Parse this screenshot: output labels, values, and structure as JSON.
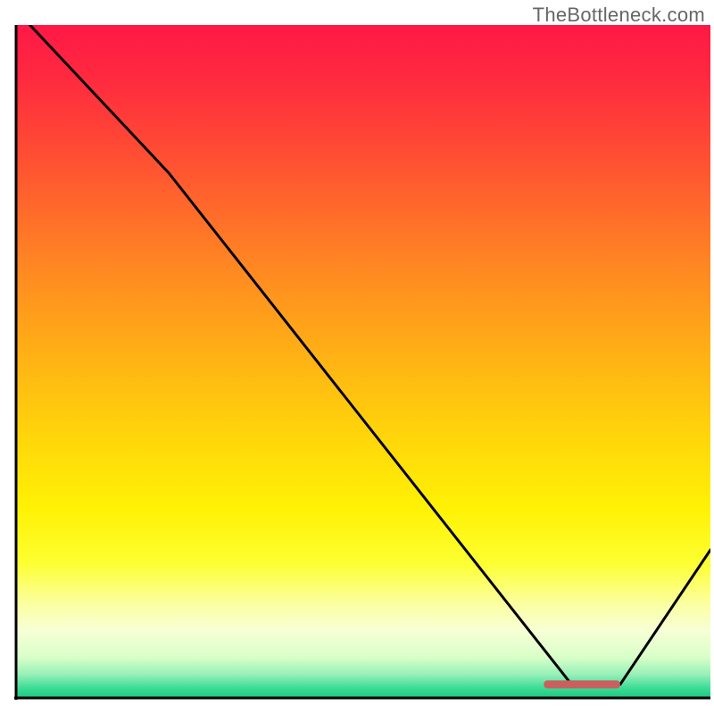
{
  "watermark": "TheBottleneck.com",
  "chart_data": {
    "type": "line",
    "title": "",
    "xlabel": "",
    "ylabel": "",
    "xlim": [
      0,
      100
    ],
    "ylim": [
      0,
      100
    ],
    "curve_points": [
      {
        "x": 2,
        "y": 100
      },
      {
        "x": 22,
        "y": 78
      },
      {
        "x": 80,
        "y": 2
      },
      {
        "x": 87,
        "y": 2
      },
      {
        "x": 100,
        "y": 22
      }
    ],
    "optimal_segment": {
      "x_start": 76,
      "x_end": 87,
      "y": 2
    },
    "gradient_stops": [
      {
        "offset": 0.0,
        "color": "#ff1846"
      },
      {
        "offset": 0.08,
        "color": "#ff2a3f"
      },
      {
        "offset": 0.2,
        "color": "#ff5032"
      },
      {
        "offset": 0.35,
        "color": "#ff8423"
      },
      {
        "offset": 0.5,
        "color": "#ffb414"
      },
      {
        "offset": 0.62,
        "color": "#ffd80a"
      },
      {
        "offset": 0.72,
        "color": "#fff205"
      },
      {
        "offset": 0.8,
        "color": "#fdff32"
      },
      {
        "offset": 0.86,
        "color": "#fbffa0"
      },
      {
        "offset": 0.9,
        "color": "#f7ffd6"
      },
      {
        "offset": 0.94,
        "color": "#d8ffc8"
      },
      {
        "offset": 0.965,
        "color": "#97f0b8"
      },
      {
        "offset": 0.985,
        "color": "#3ddc97"
      },
      {
        "offset": 1.0,
        "color": "#19c97f"
      }
    ],
    "marker_color": "#c96060",
    "axis_color": "#000000",
    "curve_color": "#000000"
  }
}
